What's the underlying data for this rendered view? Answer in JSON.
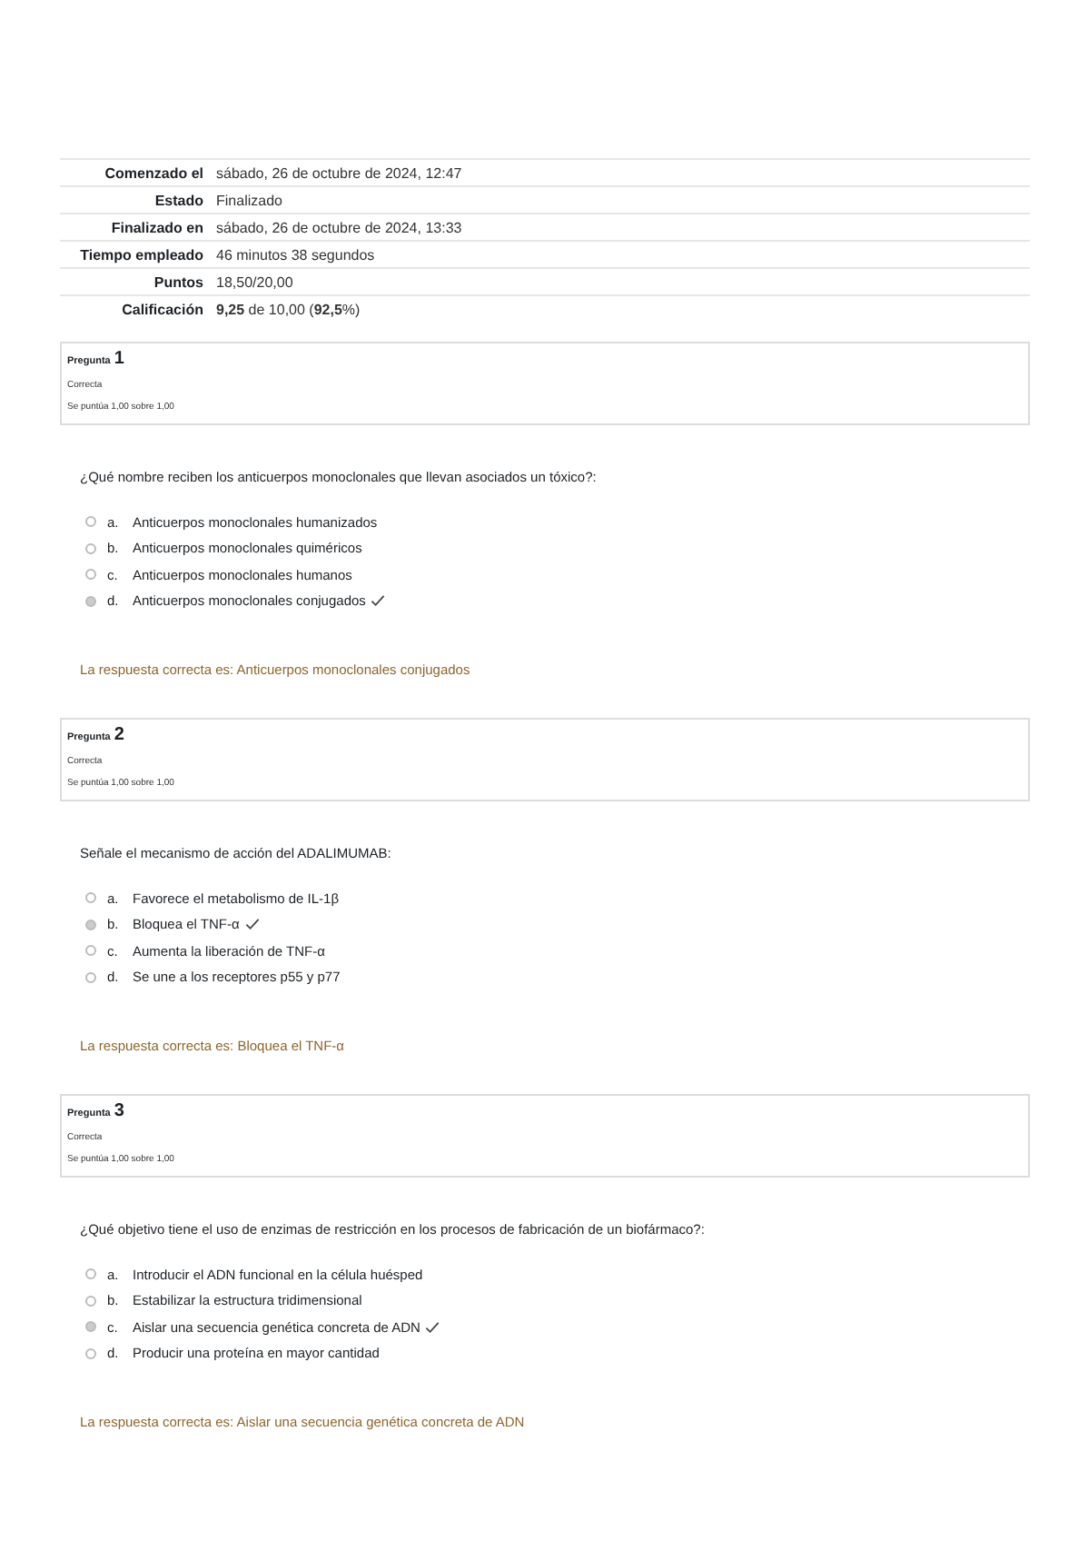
{
  "summary": [
    {
      "label": "Comenzado el",
      "value": "sábado, 26 de octubre de 2024, 12:47"
    },
    {
      "label": "Estado",
      "value": "Finalizado"
    },
    {
      "label": "Finalizado en",
      "value": "sábado, 26 de octubre de 2024, 13:33"
    },
    {
      "label": "Tiempo empleado",
      "value": "46 minutos 38 segundos"
    },
    {
      "label": "Puntos",
      "value": "18,50/20,00"
    },
    {
      "label": "Calificación",
      "value": "**9,25** de 10,00 (**92,5**%)"
    }
  ],
  "questions": [
    {
      "label": "Pregunta",
      "number": "1",
      "status": "Correcta",
      "score": "Se puntúa 1,00 sobre 1,00",
      "text": "¿Qué nombre reciben los anticuerpos monoclonales que llevan asociados un tóxico?:",
      "options": [
        {
          "letter": "a.",
          "text": "Anticuerpos monoclonales humanizados",
          "selected": false,
          "correct": false
        },
        {
          "letter": "b.",
          "text": "Anticuerpos monoclonales quiméricos",
          "selected": false,
          "correct": false
        },
        {
          "letter": "c.",
          "text": "Anticuerpos monoclonales humanos",
          "selected": false,
          "correct": false
        },
        {
          "letter": "d.",
          "text": "Anticuerpos monoclonales conjugados",
          "selected": true,
          "correct": true
        }
      ],
      "feedback": "La respuesta correcta es: Anticuerpos monoclonales conjugados"
    },
    {
      "label": "Pregunta",
      "number": "2",
      "status": "Correcta",
      "score": "Se puntúa 1,00 sobre 1,00",
      "text": "Señale el mecanismo de acción del ADALIMUMAB:",
      "options": [
        {
          "letter": "a.",
          "text": "Favorece el metabolismo de IL-1β",
          "selected": false,
          "correct": false
        },
        {
          "letter": "b.",
          "text": "Bloquea el TNF-α",
          "selected": true,
          "correct": true
        },
        {
          "letter": "c.",
          "text": "Aumenta la liberación de TNF-α",
          "selected": false,
          "correct": false
        },
        {
          "letter": "d.",
          "text": "Se une a los receptores p55 y p77",
          "selected": false,
          "correct": false
        }
      ],
      "feedback": "La respuesta correcta es: Bloquea el TNF-α"
    },
    {
      "label": "Pregunta",
      "number": "3",
      "status": "Correcta",
      "score": "Se puntúa 1,00 sobre 1,00",
      "text": "¿Qué objetivo tiene el uso de enzimas de restricción en los procesos de fabricación de un biofármaco?:",
      "options": [
        {
          "letter": "a.",
          "text": "Introducir el ADN funcional en la célula huésped",
          "selected": false,
          "correct": false
        },
        {
          "letter": "b.",
          "text": "Estabilizar la estructura tridimensional",
          "selected": false,
          "correct": false
        },
        {
          "letter": "c.",
          "text": "Aislar una secuencia genética concreta de ADN",
          "selected": true,
          "correct": true
        },
        {
          "letter": "d.",
          "text": "Producir una proteína en mayor cantidad",
          "selected": false,
          "correct": false
        }
      ],
      "feedback": "La respuesta correcta es: Aislar una secuencia genética concreta de ADN"
    }
  ]
}
